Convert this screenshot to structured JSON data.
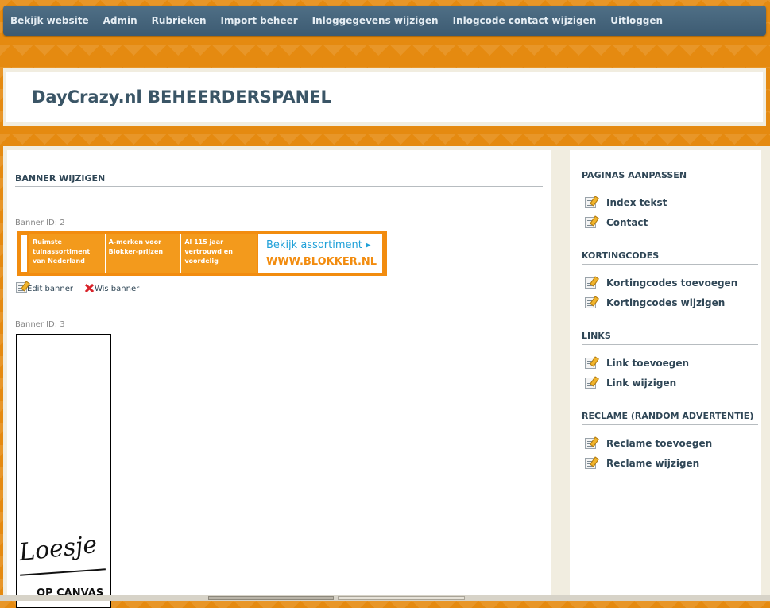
{
  "nav": {
    "items": [
      {
        "label": "Bekijk website"
      },
      {
        "label": "Admin"
      },
      {
        "label": "Rubrieken"
      },
      {
        "label": "Import beheer"
      },
      {
        "label": "Inloggegevens wijzigen"
      },
      {
        "label": "Inlogcode contact wijzigen"
      },
      {
        "label": "Uitloggen"
      }
    ]
  },
  "header": {
    "title": "DayCrazy.nl BEHEERDERSPANEL"
  },
  "main": {
    "heading": "BANNER WIJZIGEN",
    "banners": [
      {
        "id_label": "Banner ID: 2",
        "ad": {
          "brand": "BLOKKER",
          "col1": "Ruimste\ntuinassortiment\nvan Nederland",
          "col2": "A-merken voor\nBlokker-prijzen",
          "col3": "Al 115 jaar\nvertrouwd en\nvoordelig",
          "cta": "Bekijk assortiment ▸",
          "url": "WWW.BLOKKER.NL"
        },
        "edit_label": "Edit banner",
        "delete_label": "Wis banner"
      },
      {
        "id_label": "Banner ID: 3",
        "ad": {
          "signature": "Loesje",
          "caption": "OP CANVAS"
        }
      }
    ]
  },
  "sidebar": {
    "sections": [
      {
        "title": "PAGINAS AANPASSEN",
        "items": [
          {
            "label": "Index tekst"
          },
          {
            "label": "Contact"
          }
        ]
      },
      {
        "title": "KORTINGCODES",
        "items": [
          {
            "label": "Kortingcodes toevoegen"
          },
          {
            "label": "Kortingcodes wijzigen"
          }
        ]
      },
      {
        "title": "LINKS",
        "items": [
          {
            "label": "Link toevoegen"
          },
          {
            "label": "Link wijzigen"
          }
        ]
      },
      {
        "title": "RECLAME (RANDOM ADVERTENTIE)",
        "items": [
          {
            "label": "Reclame toevoegen"
          },
          {
            "label": "Reclame wijzigen"
          }
        ]
      }
    ]
  },
  "colors": {
    "nav_bg": "#4a687f",
    "page_bg": "#e58a10",
    "panel_bg": "#f1ede0",
    "heading": "#2f4656",
    "blokker_orange": "#f28c0f"
  }
}
